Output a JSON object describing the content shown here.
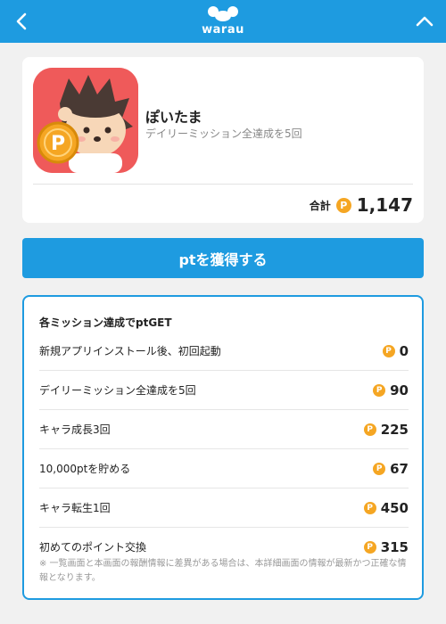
{
  "header": {
    "logo_text": "warau",
    "back_icon": "chevron-left-icon",
    "collapse_icon": "chevron-up-icon",
    "color": "#1e9be0"
  },
  "app": {
    "name": "ぽいたま",
    "subtitle": "デイリーミッション全達成を5回",
    "icon": "hedgehog-coin-app-icon",
    "total_label": "合計",
    "total_value": "1,147"
  },
  "cta": {
    "label": "ptを獲得する"
  },
  "missions": {
    "title": "各ミッション達成でptGET",
    "items": [
      {
        "label": "新規アプリインストール後、初回起動",
        "value": "0"
      },
      {
        "label": "デイリーミッション全達成を5回",
        "value": "90"
      },
      {
        "label": "キャラ成長3回",
        "value": "225"
      },
      {
        "label": "10,000ptを貯める",
        "value": "67"
      },
      {
        "label": "キャラ転生1回",
        "value": "450"
      },
      {
        "label": "初めてのポイント交換",
        "value": "315"
      }
    ],
    "footnote": "※ 一覧画面と本画面の報酬情報に差異がある場合は、本詳細画面の情報が最新かつ正確な情報となります。"
  },
  "coin_glyph": "P",
  "colors": {
    "accent": "#1e9be0",
    "coin": "#f5a623",
    "app_bg": "#ef5a5a"
  }
}
